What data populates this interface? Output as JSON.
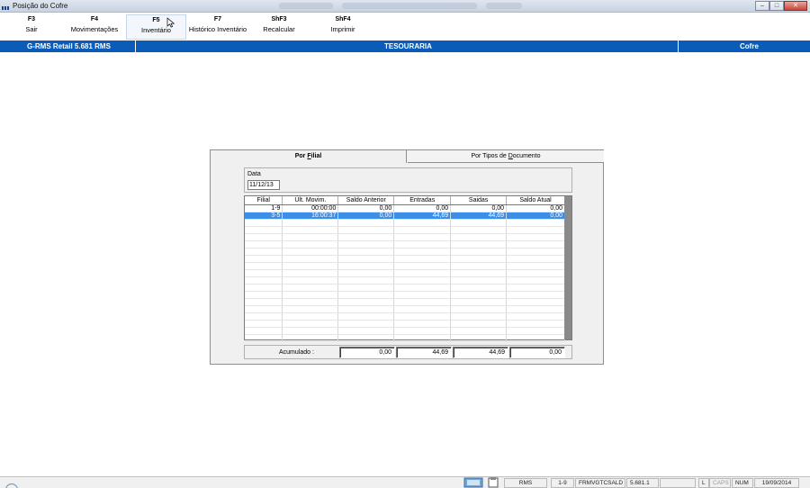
{
  "window": {
    "title": "Posição do Cofre"
  },
  "toolbar": {
    "items": [
      {
        "key": "F3",
        "label": "Sair"
      },
      {
        "key": "F4",
        "label": "Movimentações"
      },
      {
        "key": "F5",
        "label": "Inventário"
      },
      {
        "key": "F7",
        "label": "Histórico Inventário"
      },
      {
        "key": "ShF3",
        "label": "Recalcular"
      },
      {
        "key": "ShF4",
        "label": "Imprimir"
      }
    ]
  },
  "header_band": {
    "left": "G-RMS Retail 5.681 RMS",
    "center": "TESOURARIA",
    "right": "Cofre"
  },
  "tabs": {
    "active": {
      "prefix": "Por ",
      "underlined": "F",
      "suffix": "ilial"
    },
    "inactive": {
      "prefix": "Por Tipos de ",
      "underlined": "D",
      "suffix": "ocumento"
    }
  },
  "date_field": {
    "label": "Data",
    "value": "11/12/13"
  },
  "grid": {
    "columns": [
      "Filial",
      "Últ. Movim.",
      "Saldo Anterior",
      "Entradas",
      "Saidas",
      "Saldo Atual"
    ],
    "rows": [
      [
        "1-9",
        "00:00:00",
        "0,00",
        "0,00",
        "0,00",
        "0,00"
      ],
      [
        "3-5",
        "16:00:37",
        "0,00",
        "44,69",
        "44,69",
        "0,00"
      ]
    ],
    "selected_row": 1,
    "empty_rows": 17
  },
  "accumulated": {
    "label": "Acumulado :",
    "values": [
      "0,00",
      "44,69",
      "44,69",
      "0,00"
    ]
  },
  "statusbar": {
    "cells": [
      "RMS",
      "1-9",
      "FRMVGTCSALD",
      "5.681.1",
      "",
      "L",
      "CAPS",
      "NUM",
      "19/09/2014"
    ]
  },
  "colors": {
    "band": "#0a5cb8",
    "selected_row": "#3d8ee6"
  }
}
